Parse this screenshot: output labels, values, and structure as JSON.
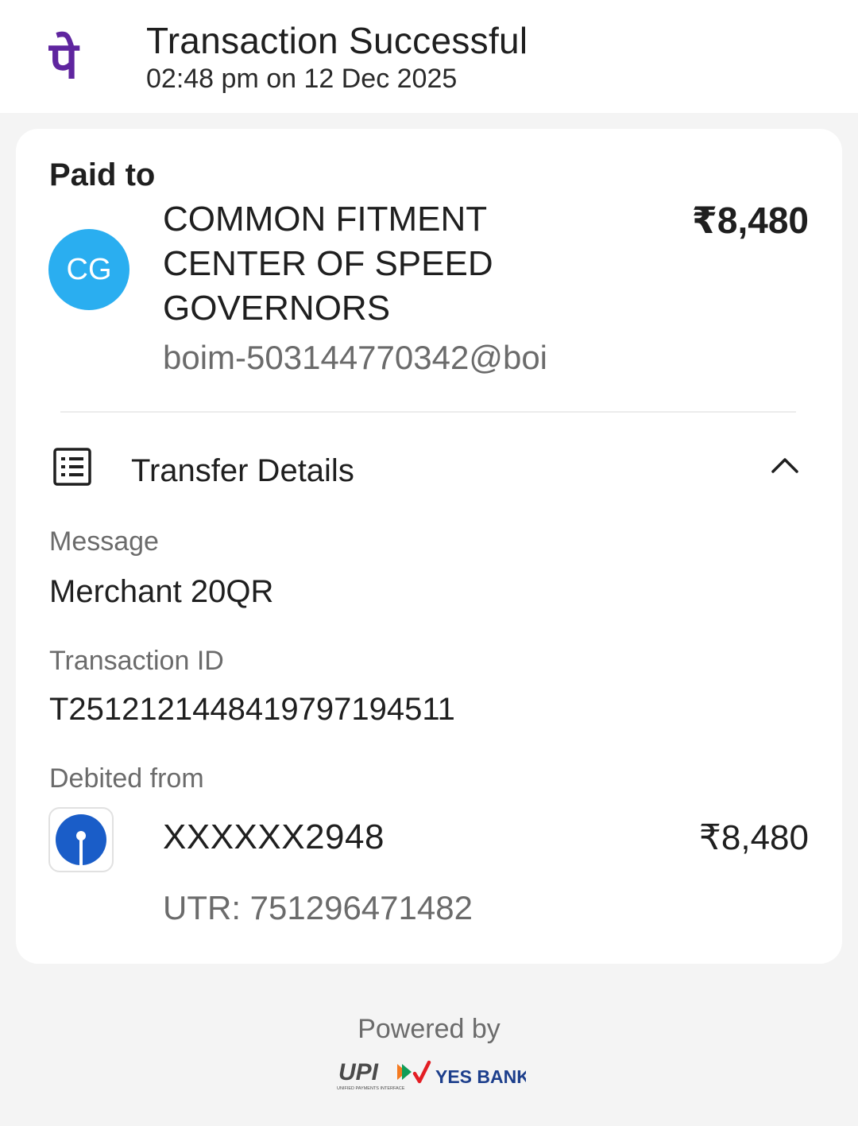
{
  "header": {
    "status": "Transaction Successful",
    "datetime": "02:48 pm on 12 Dec 2025",
    "logo_glyph": "पे",
    "brand_color": "#5f259f"
  },
  "paid_to": {
    "label": "Paid to",
    "avatar_initials": "CG",
    "avatar_color": "#2aaef0",
    "name_lines": [
      "COMMON FITMENT",
      "CENTER OF SPEED",
      "GOVERNORS"
    ],
    "upi_id": "boim-503144770342@boi",
    "amount": "₹8,480"
  },
  "transfer_details": {
    "title": "Transfer Details",
    "icon": "receipt-list-icon",
    "expanded": true,
    "message_label": "Message",
    "message_value": "Merchant 20QR",
    "transaction_id_label": "Transaction ID",
    "transaction_id_value": "T2512121448419797194511",
    "debited_from_label": "Debited from",
    "account": "XXXXXX2948",
    "debit_amount": "₹8,480",
    "utr": "UTR: 751296471482",
    "bank_logo_color": "#1a5dc8"
  },
  "footer": {
    "powered_by": "Powered by",
    "upi_text": "UPI",
    "upi_subtext": "UNIFIED PAYMENTS INTERFACE",
    "bank_text": "YES BANK"
  }
}
